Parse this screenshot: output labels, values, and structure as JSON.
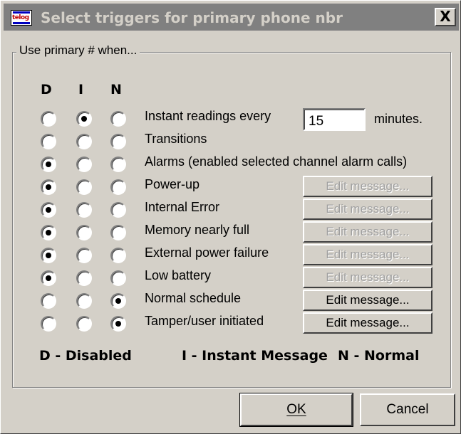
{
  "window": {
    "title": "Select triggers for primary phone nbr",
    "icon_text": "telog",
    "close_glyph": "X"
  },
  "group": {
    "label": "Use primary # when..."
  },
  "columns": [
    "D",
    "I",
    "N"
  ],
  "rows": [
    {
      "label": "Instant readings every",
      "selected": "I",
      "has_input": true
    },
    {
      "label": "Transitions",
      "selected": null
    },
    {
      "label": "Alarms (enabled selected channel alarm calls)",
      "selected": "D"
    },
    {
      "label": "Power-up",
      "selected": "D",
      "edit_enabled": false
    },
    {
      "label": "Internal Error",
      "selected": "D",
      "edit_enabled": false
    },
    {
      "label": "Memory nearly full",
      "selected": "D",
      "edit_enabled": false
    },
    {
      "label": "External power failure",
      "selected": "D",
      "edit_enabled": false
    },
    {
      "label": "Low battery",
      "selected": "D",
      "edit_enabled": false
    },
    {
      "label": "Normal schedule",
      "selected": "N",
      "edit_enabled": true
    },
    {
      "label": "Tamper/user initiated",
      "selected": "N",
      "edit_enabled": true
    }
  ],
  "interval": {
    "value": "15",
    "units": "minutes."
  },
  "edit_button_label": "Edit message...",
  "legend": {
    "d": "D - Disabled",
    "i": "I - Instant Message",
    "n": "N - Normal"
  },
  "buttons": {
    "ok_label": "OK",
    "cancel_label": "Cancel"
  }
}
